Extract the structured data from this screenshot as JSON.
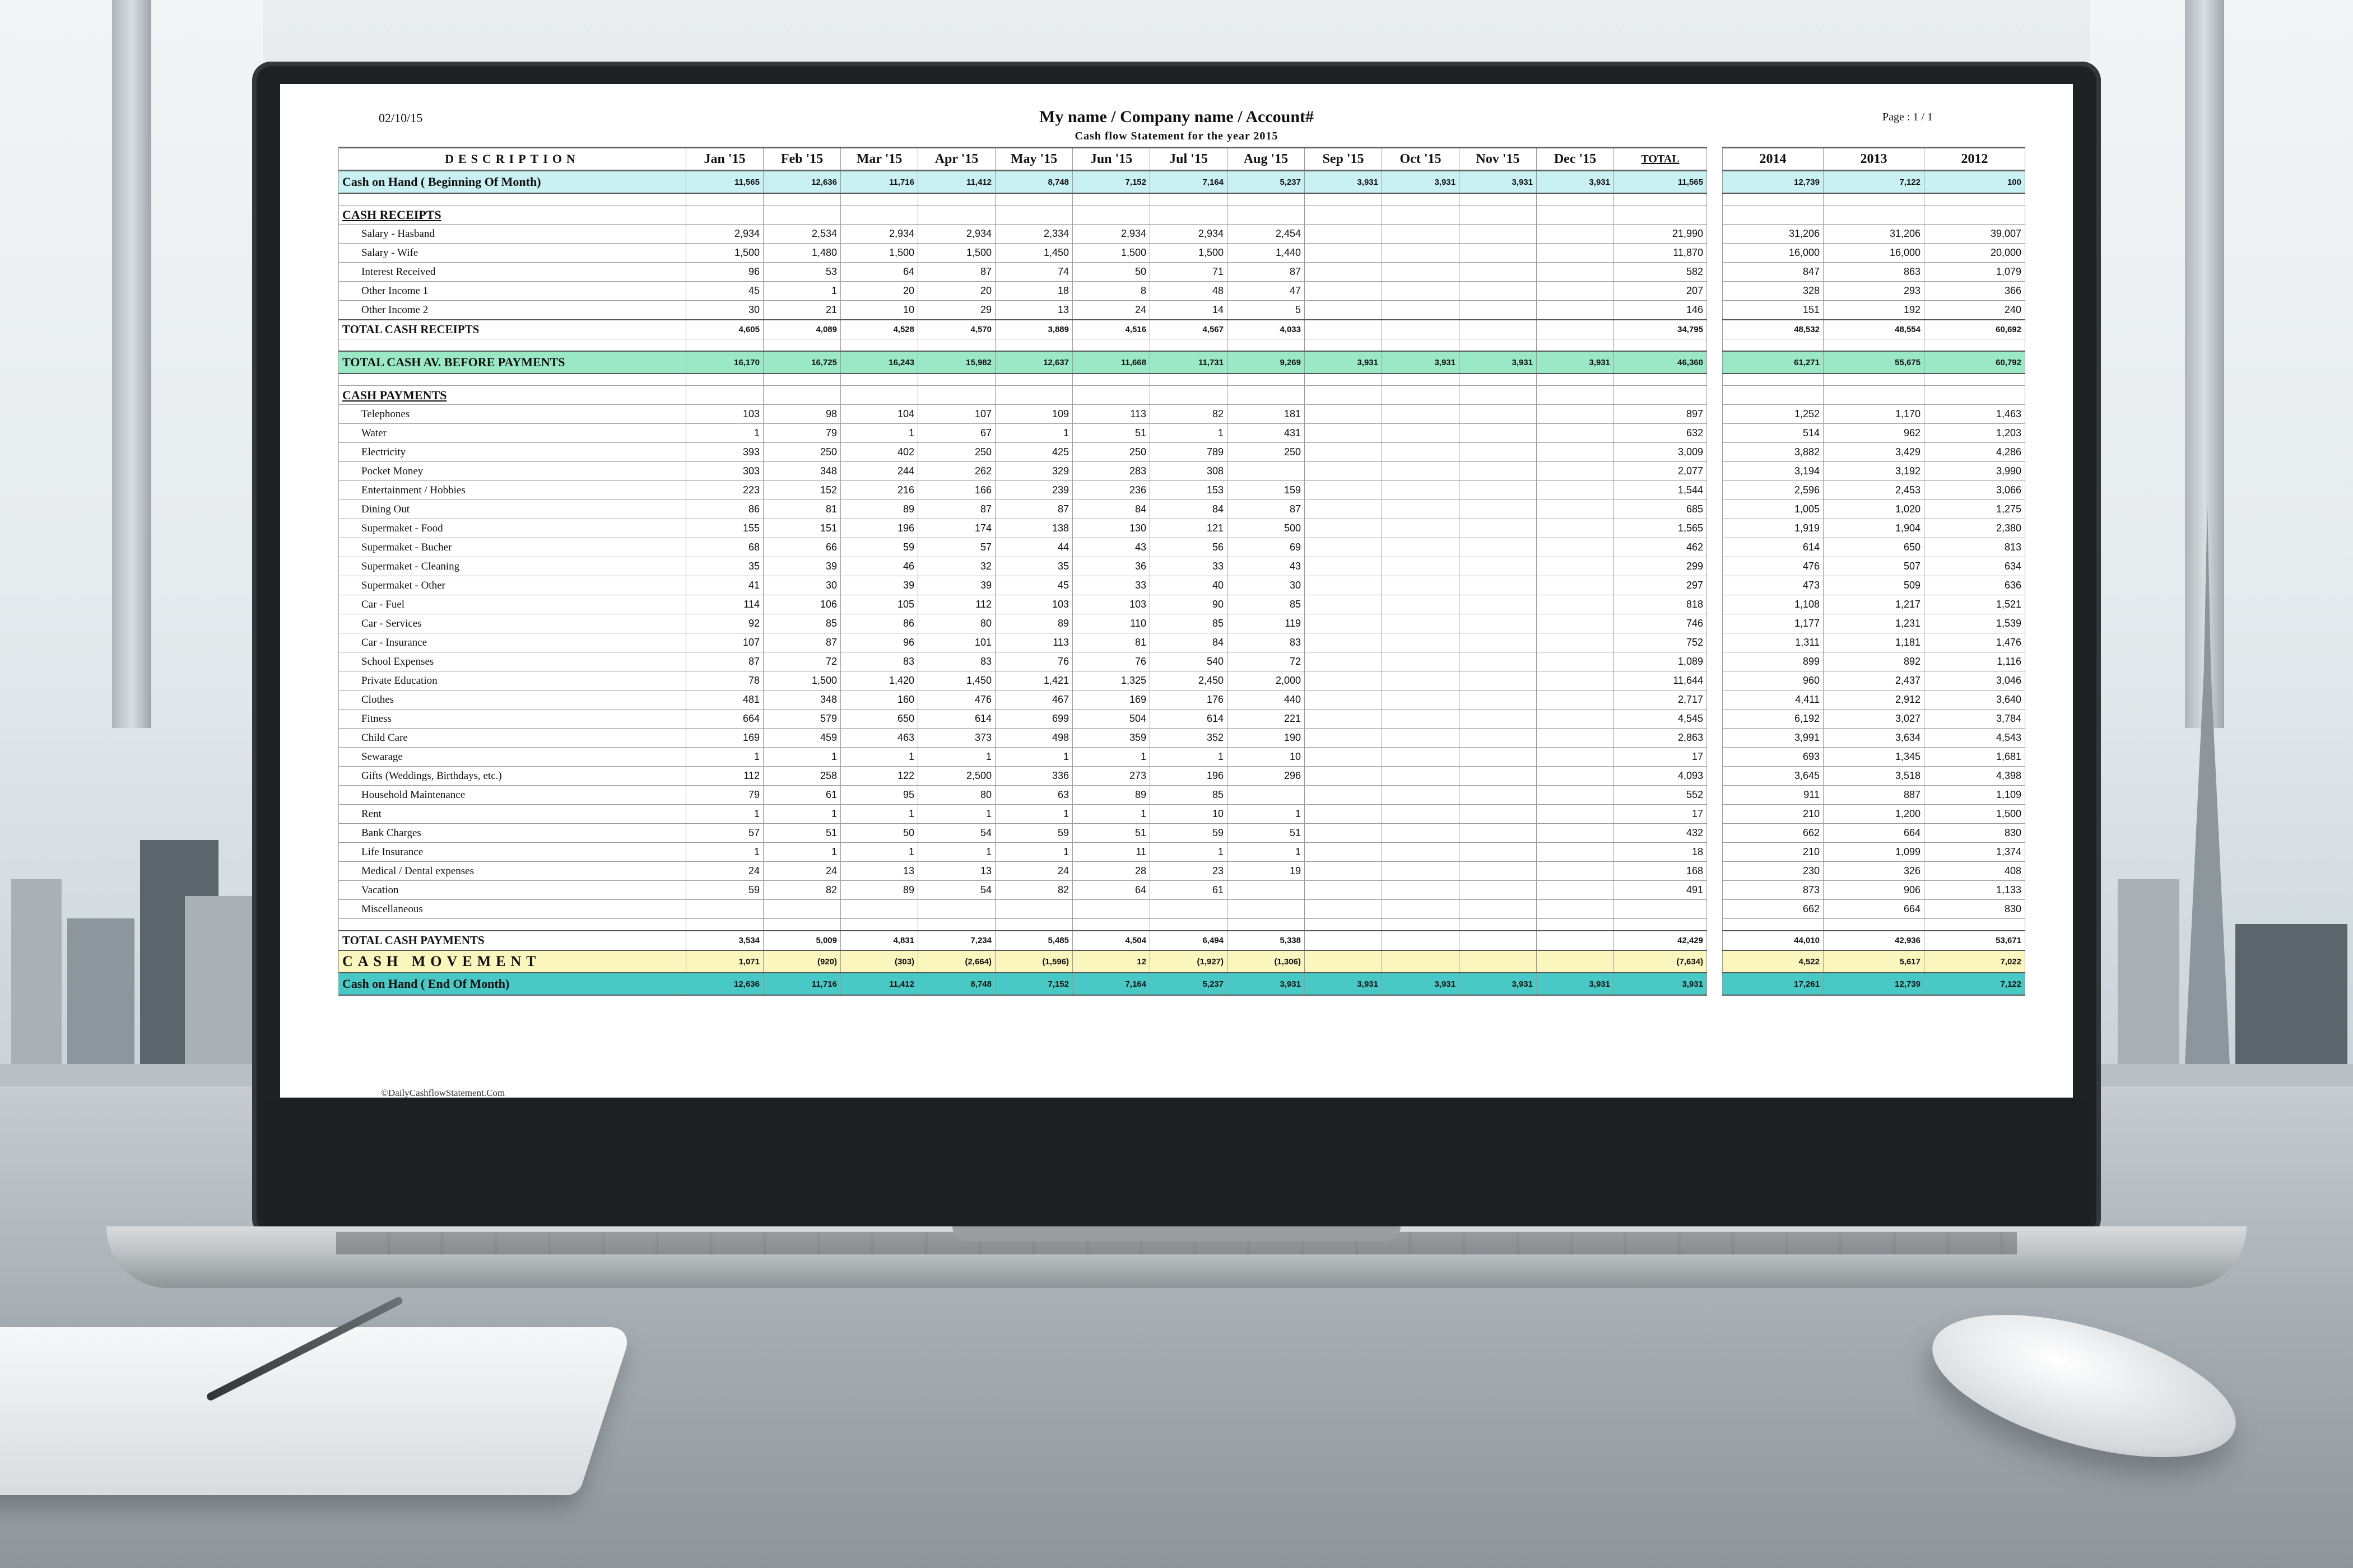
{
  "header": {
    "date": "02/10/15",
    "title": "My name / Company name / Account#",
    "subtitle": "Cash flow Statement for the year 2015",
    "page": "Page : 1 / 1"
  },
  "columns": {
    "description": "DESCRIPTION",
    "months": [
      "Jan '15",
      "Feb '15",
      "Mar '15",
      "Apr '15",
      "May '15",
      "Jun '15",
      "Jul '15",
      "Aug '15",
      "Sep '15",
      "Oct '15",
      "Nov '15",
      "Dec '15"
    ],
    "total": "TOTAL",
    "years": [
      "2014",
      "2013",
      "2012"
    ]
  },
  "rows": [
    {
      "type": "band",
      "style": "cyan",
      "label": "Cash on Hand ( Beginning Of Month)",
      "months": [
        "11,565",
        "12,636",
        "11,716",
        "11,412",
        "8,748",
        "7,152",
        "7,164",
        "5,237",
        "3,931",
        "3,931",
        "3,931",
        "3,931"
      ],
      "total": "11,565",
      "years": [
        "12,739",
        "7,122",
        "100"
      ]
    },
    {
      "type": "blank"
    },
    {
      "type": "section",
      "label": "CASH RECEIPTS"
    },
    {
      "type": "item",
      "label": "Salary - Hasband",
      "months": [
        "2,934",
        "2,534",
        "2,934",
        "2,934",
        "2,334",
        "2,934",
        "2,934",
        "2,454",
        "",
        "",
        "",
        ""
      ],
      "total": "21,990",
      "years": [
        "31,206",
        "31,206",
        "39,007"
      ]
    },
    {
      "type": "item",
      "label": "Salary - Wife",
      "months": [
        "1,500",
        "1,480",
        "1,500",
        "1,500",
        "1,450",
        "1,500",
        "1,500",
        "1,440",
        "",
        "",
        "",
        ""
      ],
      "total": "11,870",
      "years": [
        "16,000",
        "16,000",
        "20,000"
      ]
    },
    {
      "type": "item",
      "label": "Interest Received",
      "months": [
        "96",
        "53",
        "64",
        "87",
        "74",
        "50",
        "71",
        "87",
        "",
        "",
        "",
        ""
      ],
      "total": "582",
      "years": [
        "847",
        "863",
        "1,079"
      ]
    },
    {
      "type": "item",
      "label": "Other Income 1",
      "months": [
        "45",
        "1",
        "20",
        "20",
        "18",
        "8",
        "48",
        "47",
        "",
        "",
        "",
        ""
      ],
      "total": "207",
      "years": [
        "328",
        "293",
        "366"
      ]
    },
    {
      "type": "item",
      "label": "Other Income 2",
      "months": [
        "30",
        "21",
        "10",
        "29",
        "13",
        "24",
        "14",
        "5",
        "",
        "",
        "",
        ""
      ],
      "total": "146",
      "years": [
        "151",
        "192",
        "240"
      ]
    },
    {
      "type": "total",
      "label": "TOTAL CASH RECEIPTS",
      "months": [
        "4,605",
        "4,089",
        "4,528",
        "4,570",
        "3,889",
        "4,516",
        "4,567",
        "4,033",
        "",
        "",
        "",
        ""
      ],
      "total": "34,795",
      "years": [
        "48,532",
        "48,554",
        "60,692"
      ]
    },
    {
      "type": "blank"
    },
    {
      "type": "band",
      "style": "green",
      "label": "TOTAL CASH AV. BEFORE PAYMENTS",
      "months": [
        "16,170",
        "16,725",
        "16,243",
        "15,982",
        "12,637",
        "11,668",
        "11,731",
        "9,269",
        "3,931",
        "3,931",
        "3,931",
        "3,931"
      ],
      "total": "46,360",
      "years": [
        "61,271",
        "55,675",
        "60,792"
      ]
    },
    {
      "type": "blank"
    },
    {
      "type": "section",
      "label": "CASH PAYMENTS"
    },
    {
      "type": "item",
      "label": "Telephones",
      "months": [
        "103",
        "98",
        "104",
        "107",
        "109",
        "113",
        "82",
        "181",
        "",
        "",
        "",
        ""
      ],
      "total": "897",
      "years": [
        "1,252",
        "1,170",
        "1,463"
      ]
    },
    {
      "type": "item",
      "label": "Water",
      "months": [
        "1",
        "79",
        "1",
        "67",
        "1",
        "51",
        "1",
        "431",
        "",
        "",
        "",
        ""
      ],
      "total": "632",
      "years": [
        "514",
        "962",
        "1,203"
      ]
    },
    {
      "type": "item",
      "label": "Electricity",
      "months": [
        "393",
        "250",
        "402",
        "250",
        "425",
        "250",
        "789",
        "250",
        "",
        "",
        "",
        ""
      ],
      "total": "3,009",
      "years": [
        "3,882",
        "3,429",
        "4,286"
      ]
    },
    {
      "type": "item",
      "label": "Pocket Money",
      "months": [
        "303",
        "348",
        "244",
        "262",
        "329",
        "283",
        "308",
        "",
        "",
        "",
        "",
        ""
      ],
      "total": "2,077",
      "years": [
        "3,194",
        "3,192",
        "3,990"
      ]
    },
    {
      "type": "item",
      "label": "Entertainment / Hobbies",
      "months": [
        "223",
        "152",
        "216",
        "166",
        "239",
        "236",
        "153",
        "159",
        "",
        "",
        "",
        ""
      ],
      "total": "1,544",
      "years": [
        "2,596",
        "2,453",
        "3,066"
      ]
    },
    {
      "type": "item",
      "label": "Dining Out",
      "months": [
        "86",
        "81",
        "89",
        "87",
        "87",
        "84",
        "84",
        "87",
        "",
        "",
        "",
        ""
      ],
      "total": "685",
      "years": [
        "1,005",
        "1,020",
        "1,275"
      ]
    },
    {
      "type": "item",
      "label": "Supermaket - Food",
      "months": [
        "155",
        "151",
        "196",
        "174",
        "138",
        "130",
        "121",
        "500",
        "",
        "",
        "",
        ""
      ],
      "total": "1,565",
      "years": [
        "1,919",
        "1,904",
        "2,380"
      ]
    },
    {
      "type": "item",
      "label": "Supermaket - Bucher",
      "months": [
        "68",
        "66",
        "59",
        "57",
        "44",
        "43",
        "56",
        "69",
        "",
        "",
        "",
        ""
      ],
      "total": "462",
      "years": [
        "614",
        "650",
        "813"
      ]
    },
    {
      "type": "item",
      "label": "Supermaket - Cleaning",
      "months": [
        "35",
        "39",
        "46",
        "32",
        "35",
        "36",
        "33",
        "43",
        "",
        "",
        "",
        ""
      ],
      "total": "299",
      "years": [
        "476",
        "507",
        "634"
      ]
    },
    {
      "type": "item",
      "label": "Supermaket - Other",
      "months": [
        "41",
        "30",
        "39",
        "39",
        "45",
        "33",
        "40",
        "30",
        "",
        "",
        "",
        ""
      ],
      "total": "297",
      "years": [
        "473",
        "509",
        "636"
      ]
    },
    {
      "type": "item",
      "label": "Car - Fuel",
      "months": [
        "114",
        "106",
        "105",
        "112",
        "103",
        "103",
        "90",
        "85",
        "",
        "",
        "",
        ""
      ],
      "total": "818",
      "years": [
        "1,108",
        "1,217",
        "1,521"
      ]
    },
    {
      "type": "item",
      "label": "Car - Services",
      "months": [
        "92",
        "85",
        "86",
        "80",
        "89",
        "110",
        "85",
        "119",
        "",
        "",
        "",
        ""
      ],
      "total": "746",
      "years": [
        "1,177",
        "1,231",
        "1,539"
      ]
    },
    {
      "type": "item",
      "label": "Car - Insurance",
      "months": [
        "107",
        "87",
        "96",
        "101",
        "113",
        "81",
        "84",
        "83",
        "",
        "",
        "",
        ""
      ],
      "total": "752",
      "years": [
        "1,311",
        "1,181",
        "1,476"
      ]
    },
    {
      "type": "item",
      "label": "School Expenses",
      "months": [
        "87",
        "72",
        "83",
        "83",
        "76",
        "76",
        "540",
        "72",
        "",
        "",
        "",
        ""
      ],
      "total": "1,089",
      "years": [
        "899",
        "892",
        "1,116"
      ]
    },
    {
      "type": "item",
      "label": "Private Education",
      "months": [
        "78",
        "1,500",
        "1,420",
        "1,450",
        "1,421",
        "1,325",
        "2,450",
        "2,000",
        "",
        "",
        "",
        ""
      ],
      "total": "11,644",
      "years": [
        "960",
        "2,437",
        "3,046"
      ]
    },
    {
      "type": "item",
      "label": "Clothes",
      "months": [
        "481",
        "348",
        "160",
        "476",
        "467",
        "169",
        "176",
        "440",
        "",
        "",
        "",
        ""
      ],
      "total": "2,717",
      "years": [
        "4,411",
        "2,912",
        "3,640"
      ]
    },
    {
      "type": "item",
      "label": "Fitness",
      "months": [
        "664",
        "579",
        "650",
        "614",
        "699",
        "504",
        "614",
        "221",
        "",
        "",
        "",
        ""
      ],
      "total": "4,545",
      "years": [
        "6,192",
        "3,027",
        "3,784"
      ]
    },
    {
      "type": "item",
      "label": "Child Care",
      "months": [
        "169",
        "459",
        "463",
        "373",
        "498",
        "359",
        "352",
        "190",
        "",
        "",
        "",
        ""
      ],
      "total": "2,863",
      "years": [
        "3,991",
        "3,634",
        "4,543"
      ]
    },
    {
      "type": "item",
      "label": "Sewarage",
      "months": [
        "1",
        "1",
        "1",
        "1",
        "1",
        "1",
        "1",
        "10",
        "",
        "",
        "",
        ""
      ],
      "total": "17",
      "years": [
        "693",
        "1,345",
        "1,681"
      ]
    },
    {
      "type": "item",
      "label": "Gifts (Weddings, Birthdays, etc.)",
      "months": [
        "112",
        "258",
        "122",
        "2,500",
        "336",
        "273",
        "196",
        "296",
        "",
        "",
        "",
        ""
      ],
      "total": "4,093",
      "years": [
        "3,645",
        "3,518",
        "4,398"
      ]
    },
    {
      "type": "item",
      "label": "Household Maintenance",
      "months": [
        "79",
        "61",
        "95",
        "80",
        "63",
        "89",
        "85",
        "",
        "",
        "",
        "",
        ""
      ],
      "total": "552",
      "years": [
        "911",
        "887",
        "1,109"
      ]
    },
    {
      "type": "item",
      "label": "Rent",
      "months": [
        "1",
        "1",
        "1",
        "1",
        "1",
        "1",
        "10",
        "1",
        "",
        "",
        "",
        ""
      ],
      "total": "17",
      "years": [
        "210",
        "1,200",
        "1,500"
      ]
    },
    {
      "type": "item",
      "label": "Bank Charges",
      "months": [
        "57",
        "51",
        "50",
        "54",
        "59",
        "51",
        "59",
        "51",
        "",
        "",
        "",
        ""
      ],
      "total": "432",
      "years": [
        "662",
        "664",
        "830"
      ]
    },
    {
      "type": "item",
      "label": "Life Insurance",
      "months": [
        "1",
        "1",
        "1",
        "1",
        "1",
        "11",
        "1",
        "1",
        "",
        "",
        "",
        ""
      ],
      "total": "18",
      "years": [
        "210",
        "1,099",
        "1,374"
      ]
    },
    {
      "type": "item",
      "label": "Medical / Dental expenses",
      "months": [
        "24",
        "24",
        "13",
        "13",
        "24",
        "28",
        "23",
        "19",
        "",
        "",
        "",
        ""
      ],
      "total": "168",
      "years": [
        "230",
        "326",
        "408"
      ]
    },
    {
      "type": "item",
      "label": "Vacation",
      "months": [
        "59",
        "82",
        "89",
        "54",
        "82",
        "64",
        "61",
        "",
        "",
        "",
        "",
        ""
      ],
      "total": "491",
      "years": [
        "873",
        "906",
        "1,133"
      ]
    },
    {
      "type": "item",
      "label": "Miscellaneous",
      "months": [
        "",
        "",
        "",
        "",
        "",
        "",
        "",
        "",
        "",
        "",
        "",
        ""
      ],
      "total": "",
      "years": [
        "662",
        "664",
        "830"
      ]
    },
    {
      "type": "blank"
    },
    {
      "type": "total",
      "label": "TOTAL CASH PAYMENTS",
      "months": [
        "3,534",
        "5,009",
        "4,831",
        "7,234",
        "5,485",
        "4,504",
        "6,494",
        "5,338",
        "",
        "",
        "",
        ""
      ],
      "total": "42,429",
      "years": [
        "44,010",
        "42,936",
        "53,671"
      ]
    },
    {
      "type": "band",
      "style": "yellow",
      "move": true,
      "label": "CASH MOVEMENT",
      "months": [
        "1,071",
        "(920)",
        "(303)",
        "(2,664)",
        "(1,596)",
        "12",
        "(1,927)",
        "(1,306)",
        "",
        "",
        "",
        ""
      ],
      "total": "(7,634)",
      "years": [
        "4,522",
        "5,617",
        "7,022"
      ]
    },
    {
      "type": "band",
      "style": "teal",
      "label": "Cash on Hand ( End Of Month)",
      "months": [
        "12,636",
        "11,716",
        "11,412",
        "8,748",
        "7,152",
        "7,164",
        "5,237",
        "3,931",
        "3,931",
        "3,931",
        "3,931",
        "3,931"
      ],
      "total": "3,931",
      "years": [
        "17,261",
        "12,739",
        "7,122"
      ]
    }
  ],
  "footer": {
    "copyright": "©DailyCashflowStatement.Com"
  }
}
